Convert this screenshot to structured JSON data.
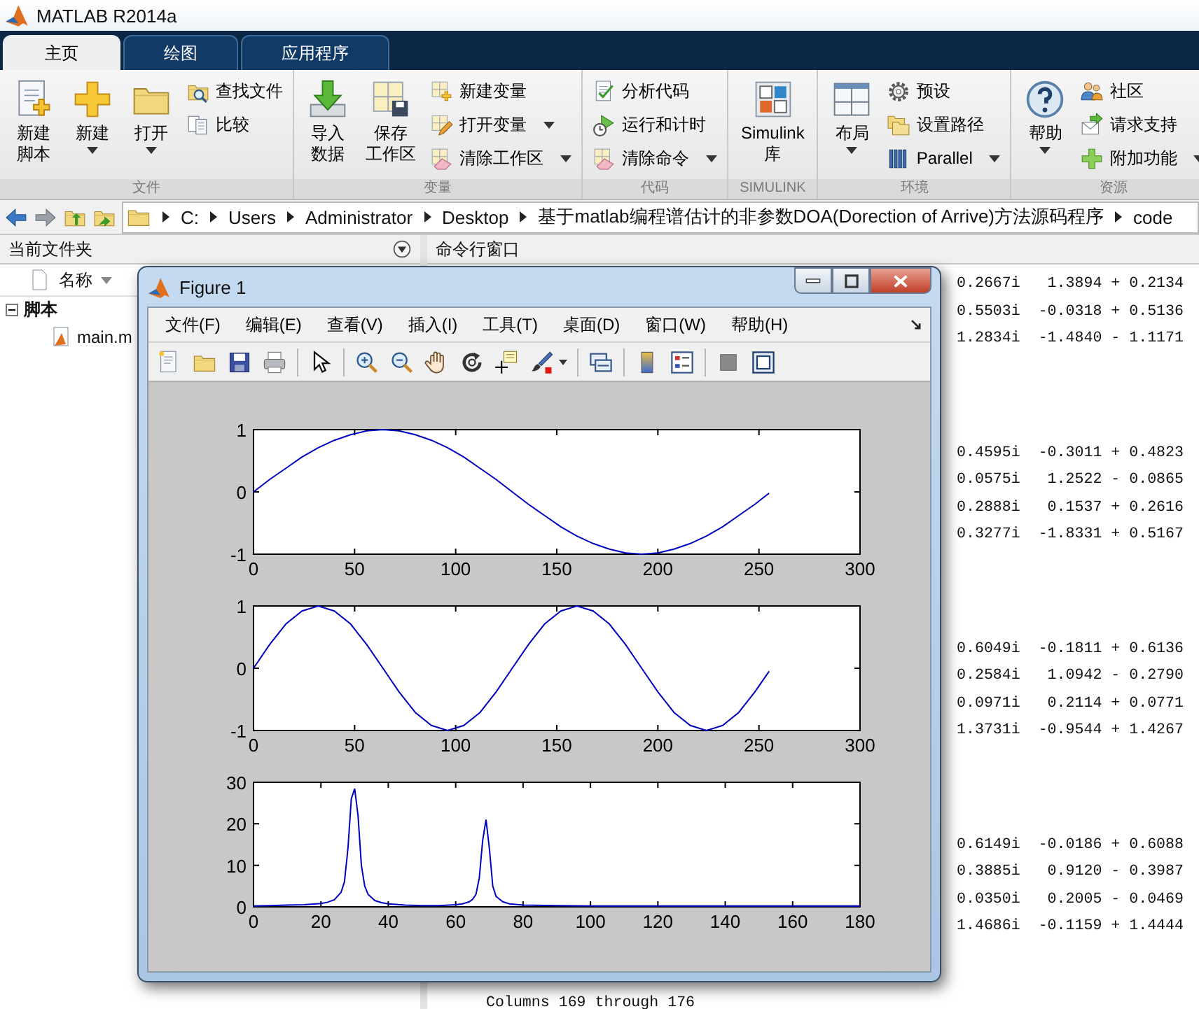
{
  "window": {
    "title": "MATLAB R2014a"
  },
  "tabs": [
    {
      "label": "主页",
      "selected": true
    },
    {
      "label": "绘图",
      "selected": false
    },
    {
      "label": "应用程序",
      "selected": false
    }
  ],
  "toolstrip": [
    {
      "label": "文件",
      "items": [
        {
          "kind": "large",
          "lines": [
            "新建",
            "脚本"
          ],
          "dropdown": false
        },
        {
          "kind": "large",
          "lines": [
            "新建"
          ],
          "dropdown": true
        },
        {
          "kind": "large",
          "lines": [
            "打开"
          ],
          "dropdown": true
        },
        {
          "kind": "small",
          "label": "查找文件",
          "dropdown": false
        },
        {
          "kind": "small",
          "label": "比较",
          "dropdown": false
        }
      ]
    },
    {
      "label": "变量",
      "items": [
        {
          "kind": "large",
          "lines": [
            "导入",
            "数据"
          ],
          "dropdown": false
        },
        {
          "kind": "large",
          "lines": [
            "保存",
            "工作区"
          ],
          "dropdown": false
        },
        {
          "kind": "small",
          "label": "新建变量",
          "dropdown": false
        },
        {
          "kind": "small",
          "label": "打开变量",
          "dropdown": true
        },
        {
          "kind": "small",
          "label": "清除工作区",
          "dropdown": true
        }
      ]
    },
    {
      "label": "代码",
      "items": [
        {
          "kind": "small",
          "label": "分析代码",
          "dropdown": false
        },
        {
          "kind": "small",
          "label": "运行和计时",
          "dropdown": false
        },
        {
          "kind": "small",
          "label": "清除命令",
          "dropdown": true
        }
      ]
    },
    {
      "label": "SIMULINK",
      "items": [
        {
          "kind": "large",
          "lines": [
            "Simulink",
            "库"
          ],
          "dropdown": false
        }
      ]
    },
    {
      "label": "环境",
      "items": [
        {
          "kind": "large",
          "lines": [
            "布局"
          ],
          "dropdown": true
        },
        {
          "kind": "small",
          "label": "预设",
          "dropdown": false
        },
        {
          "kind": "small",
          "label": "设置路径",
          "dropdown": false
        },
        {
          "kind": "small",
          "label": "Parallel",
          "dropdown": true
        }
      ]
    },
    {
      "label": "资源",
      "items": [
        {
          "kind": "large",
          "lines": [
            "帮助"
          ],
          "dropdown": true
        },
        {
          "kind": "small",
          "label": "社区",
          "dropdown": false
        },
        {
          "kind": "small",
          "label": "请求支持",
          "dropdown": false
        },
        {
          "kind": "small",
          "label": "附加功能",
          "dropdown": true
        }
      ]
    }
  ],
  "address_bar": {
    "path": [
      "C:",
      "Users",
      "Administrator",
      "Desktop",
      "基于matlab编程谱估计的非参数DOA(Dorection of Arrive)方法源码程序",
      "code"
    ]
  },
  "file_browser": {
    "title": "当前文件夹",
    "column": "名称",
    "tree": [
      {
        "label": "脚本",
        "expanded": true,
        "children": [
          {
            "label": "main.m"
          }
        ]
      }
    ]
  },
  "command_window": {
    "title": "命令行窗口",
    "blocks": [
      [
        "0.2667i   1.3894 + 0.2134",
        "0.5503i  -0.0318 + 0.5136",
        "1.2834i  -1.4840 - 1.1171"
      ],
      [
        "0.4595i  -0.3011 + 0.4823",
        "0.0575i   1.2522 - 0.0865",
        "0.2888i   0.1537 + 0.2616",
        "0.3277i  -1.8331 + 0.5167"
      ],
      [
        "0.6049i  -0.1811 + 0.6136",
        "0.2584i   1.0942 - 0.2790",
        "0.0971i   0.2114 + 0.0771",
        "1.3731i  -0.9544 + 1.4267"
      ],
      [
        "0.6149i  -0.0186 + 0.6088",
        "0.3885i   0.9120 - 0.3987",
        "0.0350i   0.2005 - 0.0469",
        "1.4686i  -0.1159 + 1.4444"
      ]
    ],
    "last_line": "Columns 169 through 176"
  },
  "figure": {
    "title": "Figure 1",
    "menu": [
      "文件(F)",
      "编辑(E)",
      "查看(V)",
      "插入(I)",
      "工具(T)",
      "桌面(D)",
      "窗口(W)",
      "帮助(H)"
    ],
    "axes": [
      {
        "chart_data": {
          "type": "line",
          "x": [
            0,
            8,
            16,
            24,
            32,
            40,
            48,
            56,
            64,
            72,
            80,
            88,
            96,
            104,
            112,
            120,
            128,
            136,
            144,
            152,
            160,
            168,
            176,
            184,
            192,
            200,
            208,
            216,
            224,
            232,
            240,
            248,
            255
          ],
          "series": [
            {
              "color": "#0000c0",
              "values": [
                0,
                0.2,
                0.38,
                0.56,
                0.71,
                0.83,
                0.92,
                0.98,
                1,
                0.98,
                0.92,
                0.83,
                0.71,
                0.56,
                0.38,
                0.2,
                0,
                -0.2,
                -0.38,
                -0.56,
                -0.71,
                -0.83,
                -0.92,
                -0.98,
                -1,
                -0.98,
                -0.92,
                -0.83,
                -0.71,
                -0.56,
                -0.38,
                -0.2,
                -0.02
              ]
            }
          ],
          "xlim": [
            0,
            300
          ],
          "ylim": [
            -1,
            1
          ],
          "xticks": [
            0,
            50,
            100,
            150,
            200,
            250,
            300
          ],
          "yticks": [
            -1,
            0,
            1
          ]
        }
      },
      {
        "chart_data": {
          "type": "line",
          "x": [
            0,
            8,
            16,
            24,
            32,
            40,
            48,
            56,
            64,
            72,
            80,
            88,
            96,
            104,
            112,
            120,
            128,
            136,
            144,
            152,
            160,
            168,
            176,
            184,
            192,
            200,
            208,
            216,
            224,
            232,
            240,
            248,
            255
          ],
          "series": [
            {
              "color": "#0000c0",
              "values": [
                0,
                0.38,
                0.71,
                0.92,
                1,
                0.92,
                0.71,
                0.38,
                0,
                -0.38,
                -0.71,
                -0.92,
                -1,
                -0.92,
                -0.71,
                -0.38,
                0,
                0.38,
                0.71,
                0.92,
                1,
                0.92,
                0.71,
                0.38,
                0,
                -0.38,
                -0.71,
                -0.92,
                -1,
                -0.92,
                -0.71,
                -0.38,
                -0.05
              ]
            }
          ],
          "xlim": [
            0,
            300
          ],
          "ylim": [
            -1,
            1
          ],
          "xticks": [
            0,
            50,
            100,
            150,
            200,
            250,
            300
          ],
          "yticks": [
            -1,
            0,
            1
          ]
        }
      },
      {
        "chart_data": {
          "type": "line",
          "x": [
            0,
            5,
            10,
            15,
            20,
            22,
            24,
            26,
            27,
            28,
            29,
            30,
            31,
            32,
            33,
            34,
            36,
            38,
            40,
            45,
            50,
            55,
            60,
            62,
            64,
            65,
            66,
            67,
            68,
            69,
            70,
            71,
            72,
            74,
            76,
            80,
            90,
            100,
            110,
            120,
            130,
            140,
            150,
            160,
            170,
            180
          ],
          "series": [
            {
              "color": "#0000c0",
              "values": [
                0.2,
                0.3,
                0.4,
                0.5,
                0.8,
                1.1,
                1.7,
                3.5,
                6,
                14,
                26,
                28.5,
                22,
                10,
                5,
                3,
                1.5,
                1,
                0.7,
                0.4,
                0.3,
                0.3,
                0.5,
                0.7,
                1.2,
                1.8,
                3,
                7,
                16,
                21,
                14,
                5,
                2.5,
                1.2,
                0.7,
                0.4,
                0.3,
                0.2,
                0.2,
                0.2,
                0.2,
                0.2,
                0.2,
                0.2,
                0.2,
                0.2
              ]
            }
          ],
          "xlim": [
            0,
            180
          ],
          "ylim": [
            0,
            30
          ],
          "xticks": [
            0,
            20,
            40,
            60,
            80,
            100,
            120,
            140,
            160,
            180
          ],
          "yticks": [
            0,
            10,
            20,
            30
          ]
        }
      }
    ]
  }
}
